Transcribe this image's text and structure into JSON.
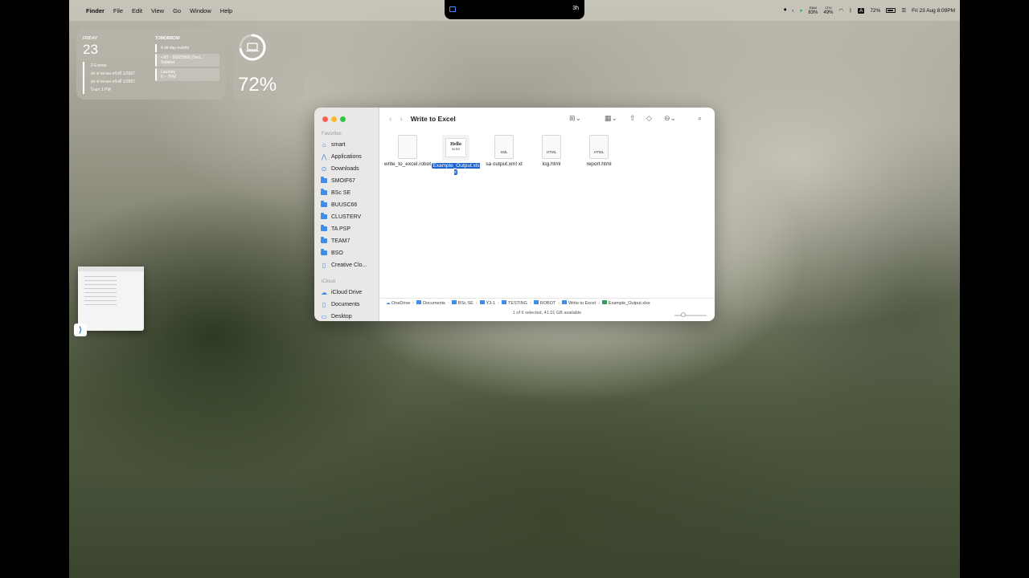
{
  "menubar": {
    "app": "Finder",
    "items": [
      "File",
      "Edit",
      "View",
      "Go",
      "Window",
      "Help"
    ],
    "notch_timer": "3h",
    "ram_label": "RAM",
    "ram_value": "83%",
    "cpu_label": "CPU",
    "cpu_value": "49%",
    "battery_pct": "72%",
    "datetime": "Fri 23 Aug  8:09PM"
  },
  "calendar_widget": {
    "today_label": "FRIDAY",
    "today_num": "23",
    "today_events_count": "2 Events",
    "today_event_1": "ส่ง ค่ายกลอ คร้งที่ 1/2567",
    "today_event_2": "ส่ง ค่ายกลอ คร้งที่ 1/2567",
    "today_time": "ไกอก 1 PM",
    "tomorrow_label": "TOMORROW",
    "all_day": "4 all-day events",
    "event_a": "• M7 - 66823966 (Test...",
    "event_a_sub": "Subtest",
    "event_b": "Laundry",
    "event_b_time": "6 – 7PM"
  },
  "battery_widget": {
    "percent": "72%",
    "level": 0.72
  },
  "finder": {
    "title": "Write to Excel",
    "sidebar": {
      "favorites_label": "Favorites",
      "favorites": [
        "smart",
        "Applications",
        "Downloads",
        "SMOIF67",
        "BSc SE",
        "BUUSC66",
        "CLUSTERV",
        "TA PSP",
        "TEAM7",
        "BSO",
        "Creative Clo..."
      ],
      "icloud_label": "iCloud",
      "icloud": [
        "iCloud Drive",
        "Documents",
        "Desktop"
      ]
    },
    "files": [
      {
        "name": "write_to_excel.robot",
        "label": ""
      },
      {
        "name": "Example_Output.xlsx",
        "label": "XLSX",
        "preview": "Hello"
      },
      {
        "name": "sa output.xml xt",
        "label": "XML"
      },
      {
        "name": "log.html",
        "label": "HTML"
      },
      {
        "name": "report.html",
        "label": "HTML"
      }
    ],
    "path": [
      "OneDrive",
      "Documents",
      "BSc SE",
      "Y3-1",
      "TESTING",
      "ROBOT",
      "Write to Excel",
      "Example_Output.xlsx"
    ],
    "status": "1 of 6 selected, 41.01 GB available"
  }
}
